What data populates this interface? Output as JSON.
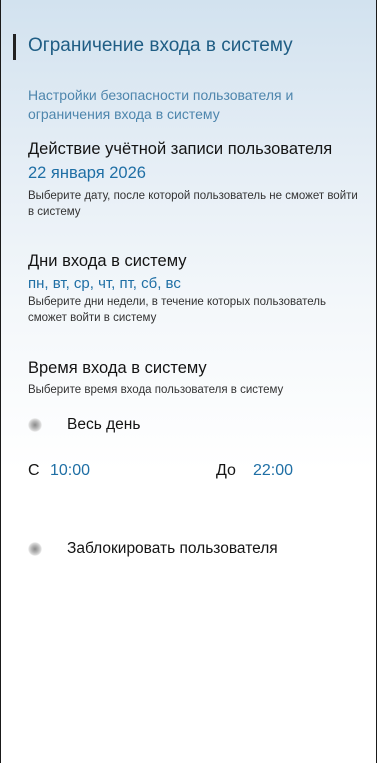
{
  "page": {
    "title": "Ограничение входа в систему",
    "subtitle": "Настройки безопасности пользователя и ограничения входа в систему"
  },
  "account_expiry": {
    "heading": "Действие учётной записи пользователя",
    "value": "22 января 2026",
    "hint": "Выберите дату, после которой пользователь не сможет войти в систему"
  },
  "login_days": {
    "heading": "Дни входа в систему",
    "value": "пн, вт, ср, чт, пт, сб, вс",
    "hint": "Выберите дни недели, в течение которых пользователь сможет войти в систему"
  },
  "login_time": {
    "heading": "Время входа в систему",
    "hint": "Выберите время входа пользователя в систему",
    "all_day_label": "Весь день",
    "all_day_enabled": false,
    "from_label": "С",
    "from_value": "10:00",
    "to_label": "До",
    "to_value": "22:00"
  },
  "block_user": {
    "label": "Заблокировать пользователя",
    "enabled": false
  },
  "colors": {
    "title": "#1f5d84",
    "accent": "#1f6fa5",
    "subtitle": "#4e86ad"
  }
}
